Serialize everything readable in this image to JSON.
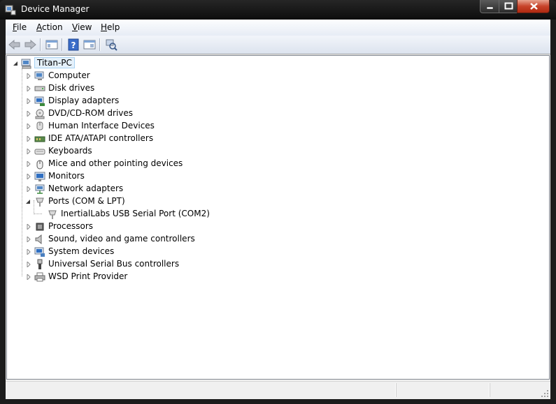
{
  "window": {
    "title": "Device Manager"
  },
  "menu": [
    {
      "label_ul": "F",
      "label_rest": "ile"
    },
    {
      "label_ul": "A",
      "label_rest": "ction"
    },
    {
      "label_ul": "V",
      "label_rest": "iew"
    },
    {
      "label_ul": "H",
      "label_rest": "elp"
    }
  ],
  "toolbar": {
    "buttons": [
      "back-icon",
      "forward-icon",
      "show-hide-console-tree-icon",
      "help-icon",
      "properties-icon",
      "scan-hardware-icon"
    ]
  },
  "tree": {
    "root": "Titan-PC",
    "categories": [
      {
        "label": "Computer",
        "icon": "computer-icon",
        "expanded": false
      },
      {
        "label": "Disk drives",
        "icon": "disk-drive-icon",
        "expanded": false
      },
      {
        "label": "Display adapters",
        "icon": "display-adapter-icon",
        "expanded": false
      },
      {
        "label": "DVD/CD-ROM drives",
        "icon": "dvd-drive-icon",
        "expanded": false
      },
      {
        "label": "Human Interface Devices",
        "icon": "hid-icon",
        "expanded": false
      },
      {
        "label": "IDE ATA/ATAPI controllers",
        "icon": "ide-controller-icon",
        "expanded": false
      },
      {
        "label": "Keyboards",
        "icon": "keyboard-icon",
        "expanded": false
      },
      {
        "label": "Mice and other pointing devices",
        "icon": "mouse-icon",
        "expanded": false
      },
      {
        "label": "Monitors",
        "icon": "monitor-icon",
        "expanded": false
      },
      {
        "label": "Network adapters",
        "icon": "network-adapter-icon",
        "expanded": false
      },
      {
        "label": "Ports (COM & LPT)",
        "icon": "port-icon",
        "expanded": true,
        "children": [
          {
            "label": "InertialLabs USB Serial Port (COM2)",
            "icon": "port-icon"
          }
        ]
      },
      {
        "label": "Processors",
        "icon": "processor-icon",
        "expanded": false
      },
      {
        "label": "Sound, video and game controllers",
        "icon": "speaker-icon",
        "expanded": false
      },
      {
        "label": "System devices",
        "icon": "system-device-icon",
        "expanded": false
      },
      {
        "label": "Universal Serial Bus controllers",
        "icon": "usb-icon",
        "expanded": false
      },
      {
        "label": "WSD Print Provider",
        "icon": "printer-icon",
        "expanded": false
      }
    ]
  },
  "colors": {
    "selection_bg": "#e5f1fb",
    "selection_border": "#a8d2f3",
    "titlebar": "#1c1c1c",
    "close_button": "#c7432a"
  }
}
